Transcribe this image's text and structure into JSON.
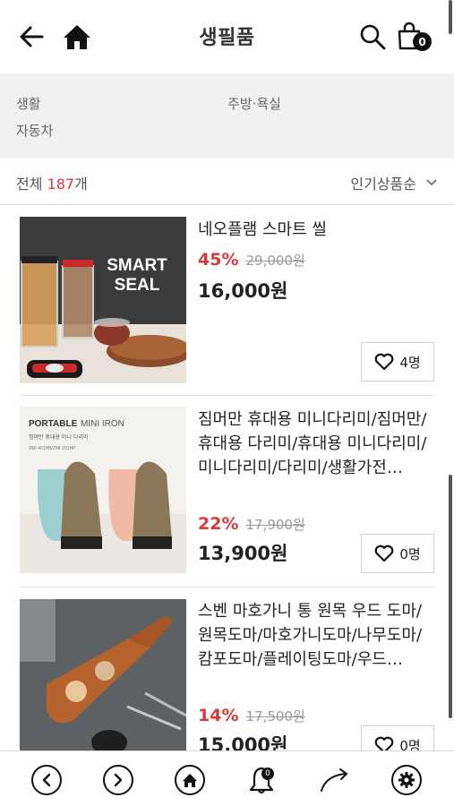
{
  "header": {
    "title": "생필품",
    "cart_count": "0"
  },
  "categories": [
    "생활",
    "주방·욕실",
    "자동차"
  ],
  "list_info": {
    "total_prefix": "전체 ",
    "total_count": "187",
    "total_suffix": "개",
    "sort_label": "인기상품순"
  },
  "products": [
    {
      "name": "네오플램 스마트 씰",
      "discount": "45%",
      "original_price": "29,000원",
      "price": "16,000원",
      "likes": "4명",
      "image_text": [
        "SMART",
        "SEAL"
      ]
    },
    {
      "name": "짐머만 휴대용 미니다리미/짐머만/휴대용 다리미/휴대용 미니다리미/미니다리미/다리미/생활가전…",
      "discount": "22%",
      "original_price": "17,900원",
      "price": "13,900원",
      "likes": "0명",
      "image_text": [
        "PORTABLE",
        "MINI IRON",
        "짐머만 휴대용 미니 다리미",
        "ZMI-401HB/ZMI-201HP"
      ]
    },
    {
      "name": "스벤 마호가니 통 원목 우드 도마/원목도마/마호가니도마/나무도마/캄포도마/플레이팅도마/우드…",
      "discount": "14%",
      "original_price": "17,500원",
      "price": "15,000원",
      "likes": "0명"
    }
  ],
  "bottom_nav": {
    "notification_count": "0"
  }
}
